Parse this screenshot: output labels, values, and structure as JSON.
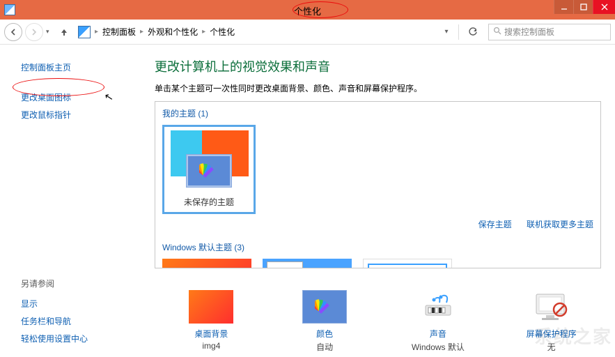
{
  "window": {
    "title": "个性化",
    "controls": {
      "minimize": "minimize",
      "maximize": "maximize",
      "close": "close"
    }
  },
  "nav": {
    "breadcrumbs": [
      "控制面板",
      "外观和个性化",
      "个性化"
    ],
    "search_placeholder": "搜索控制面板"
  },
  "sidebar": {
    "home": "控制面板主页",
    "links": [
      "更改桌面图标",
      "更改鼠标指针"
    ],
    "see_also_header": "另请参阅",
    "see_also": [
      "显示",
      "任务栏和导航",
      "轻松使用设置中心"
    ]
  },
  "main": {
    "title": "更改计算机上的视觉效果和声音",
    "subtitle": "单击某个主题可一次性同时更改桌面背景、颜色、声音和屏幕保护程序。",
    "my_themes_header": "我的主题 (1)",
    "my_theme_name": "未保存的主题",
    "link_save": "保存主题",
    "link_more": "联机获取更多主题",
    "default_header": "Windows 默认主题 (3)"
  },
  "bottom": {
    "items": [
      {
        "label": "桌面背景",
        "sub": "img4",
        "icon": "wallpaper-icon"
      },
      {
        "label": "颜色",
        "sub": "自动",
        "icon": "color-icon"
      },
      {
        "label": "声音",
        "sub": "Windows 默认",
        "icon": "sound-icon"
      },
      {
        "label": "屏幕保护程序",
        "sub": "无",
        "icon": "screensaver-icon"
      }
    ]
  },
  "annotations": {
    "title_circled": true,
    "sidebar_link_circled_index": 0
  }
}
